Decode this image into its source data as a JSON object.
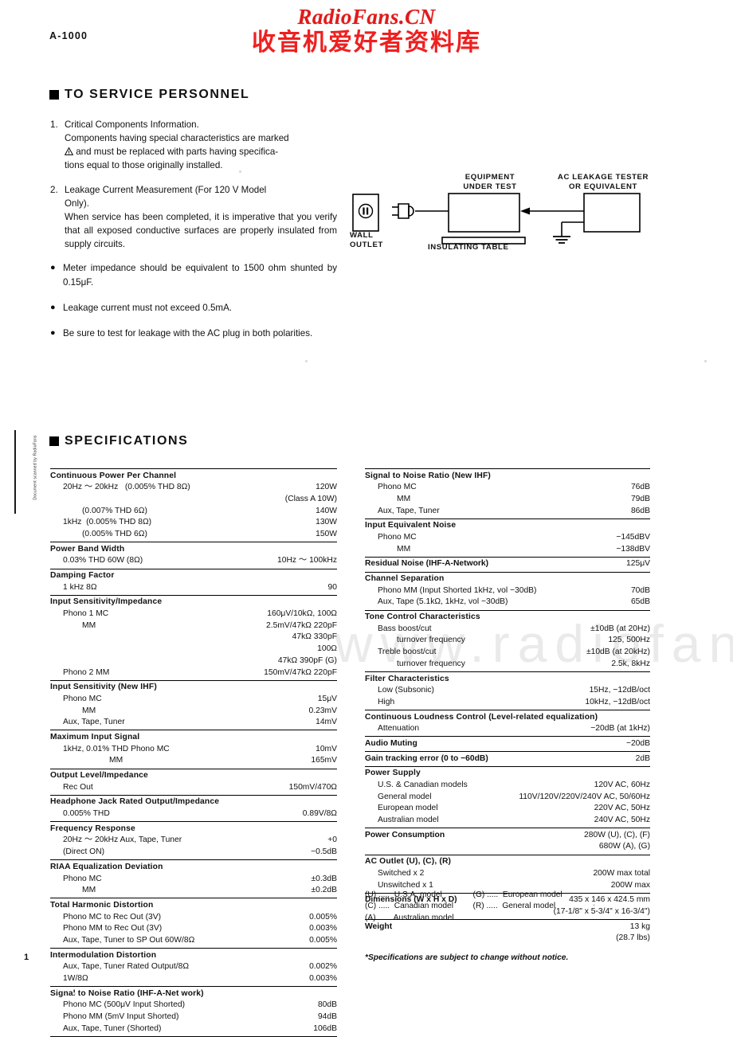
{
  "watermark": {
    "latin": "RadioFans.CN",
    "cjk": "收音机爱好者资料库",
    "middle": "www.radiofans.c"
  },
  "header": {
    "model": "A-1000",
    "page_number": "1",
    "margin_text": "Document scanned by RadioFans"
  },
  "service_section": {
    "heading": "TO SERVICE PERSONNEL",
    "items": [
      {
        "num": "1.",
        "line1": "Critical Components Information.",
        "line2_a": "Components having special characteristics are marked",
        "line2_b": "and must be replaced with parts having specifica-",
        "line2_c": "tions equal to those originally installed."
      },
      {
        "num": "2.",
        "line1": "Leakage Current Measurement (For  120  V  Model",
        "line2": "Only).",
        "line3": "When service has been completed, it is imperative that you verify that all exposed conductive surfaces are properly insulated from supply circuits."
      }
    ],
    "bullets": [
      "Meter  impedance  should  be  equivalent  to  1500  ohm shunted by 0.15μF.",
      "Leakage current must not exceed 0.5mA.",
      "Be  sure  to  test  for  leakage  with  the  AC  plug  in  both polarities."
    ]
  },
  "diagram": {
    "equipment_under_test": "EQUIPMENT\nUNDER TEST",
    "ac_leakage_tester": "AC LEAKAGE TESTER\nOR EQUIVALENT",
    "wall_outlet": "WALL\nOUTLET",
    "insulating_table": "INSULATING TABLE"
  },
  "spec_section": {
    "heading": "SPECIFICATIONS",
    "note": "*Specifications are subject to change without notice.",
    "left_groups": [
      {
        "title": "Continuous Power Per Channel",
        "rows": [
          {
            "indent": 1,
            "label": "20Hz ～ 20kHz   (0.005% THD 8Ω)",
            "value": "120W"
          },
          {
            "indent": 1,
            "label": "",
            "value": "(Class A 10W)"
          },
          {
            "indent": 2,
            "label": "(0.007% THD 6Ω)",
            "value": "140W"
          },
          {
            "indent": 1,
            "label": "1kHz  (0.005% THD 8Ω)",
            "value": "130W"
          },
          {
            "indent": 2,
            "label": "(0.005% THD 6Ω)",
            "value": "150W"
          }
        ]
      },
      {
        "title": "Power Band Width",
        "rows": [
          {
            "indent": 1,
            "label": "0.03% THD 60W (8Ω)",
            "value": "10Hz ～ 100kHz"
          }
        ]
      },
      {
        "title": "Damping Factor",
        "rows": [
          {
            "indent": 1,
            "label": "1 kHz 8Ω",
            "value": "90"
          }
        ]
      },
      {
        "title": "Input Sensitivity/Impedance",
        "rows": [
          {
            "indent": 1,
            "label": "Phono 1 MC",
            "value": "160μV/10kΩ, 100Ω"
          },
          {
            "indent": 2,
            "label": "MM",
            "value": "2.5mV/47kΩ 220pF"
          },
          {
            "indent": 1,
            "label": "",
            "value": "47kΩ 330pF"
          },
          {
            "indent": 1,
            "label": "",
            "value": "100Ω"
          },
          {
            "indent": 1,
            "label": "",
            "value": "47kΩ 390pF  (G)"
          },
          {
            "indent": 1,
            "label": "Phono 2 MM",
            "value": "150mV/47kΩ 220pF"
          }
        ]
      },
      {
        "title": "Input Sensitivity (New IHF)",
        "rows": [
          {
            "indent": 1,
            "label": "Phono MC",
            "value": "15μV"
          },
          {
            "indent": 2,
            "label": "MM",
            "value": "0.23mV"
          },
          {
            "indent": 1,
            "label": "Aux, Tape, Tuner",
            "value": "14mV"
          }
        ]
      },
      {
        "title": "Maximum Input Signal",
        "rows": [
          {
            "indent": 1,
            "label": "1kHz, 0.01% THD Phono MC",
            "value": "10mV"
          },
          {
            "indent": 3,
            "label": "MM",
            "value": "165mV"
          }
        ]
      },
      {
        "title": "Output  Level/Impedance",
        "rows": [
          {
            "indent": 1,
            "label": "Rec Out",
            "value": "150mV/470Ω"
          }
        ]
      },
      {
        "title": "Headphone Jack Rated Output/Impedance",
        "rows": [
          {
            "indent": 1,
            "label": "0.005% THD",
            "value": "0.89V/8Ω"
          }
        ]
      },
      {
        "title": "Frequency Response",
        "rows": [
          {
            "indent": 1,
            "label": "20Hz ～ 20kHz Aux, Tape, Tuner",
            "value": "+0"
          },
          {
            "indent": 1,
            "label": "(Direct ON)",
            "value": "−0.5dB"
          }
        ]
      },
      {
        "title": "RIAA Equalization Deviation",
        "rows": [
          {
            "indent": 1,
            "label": "Phono MC",
            "value": "±0.3dB"
          },
          {
            "indent": 2,
            "label": "MM",
            "value": "±0.2dB"
          }
        ]
      },
      {
        "title": "Total Harmonic Distortion",
        "rows": [
          {
            "indent": 1,
            "label": "Phono MC to Rec Out (3V)",
            "value": "0.005%"
          },
          {
            "indent": 1,
            "label": "Phono MM to Rec Out (3V)",
            "value": "0.003%"
          },
          {
            "indent": 1,
            "label": "Aux, Tape, Tuner to SP Out 60W/8Ω",
            "value": "0.005%"
          }
        ]
      },
      {
        "title": "Intermodulation Distortion",
        "rows": [
          {
            "indent": 1,
            "label": "Aux, Tape, Tuner Rated Output/8Ω",
            "value": "0.002%"
          },
          {
            "indent": 1,
            "label": "1W/8Ω",
            "value": "0.003%"
          }
        ]
      },
      {
        "title": "Signal to Noise Ratio (IHF-A-Net work)",
        "rows": [
          {
            "indent": 1,
            "label": "Phono MC (500μV Input Shorted)",
            "value": "80dB"
          },
          {
            "indent": 1,
            "label": "Phono MM (5mV Input Shorted)",
            "value": "94dB"
          },
          {
            "indent": 1,
            "label": "Aux, Tape, Tuner (Shorted)",
            "value": "106dB"
          }
        ]
      }
    ],
    "right_groups": [
      {
        "title": "Signal to Noise Ratio (New IHF)",
        "rows": [
          {
            "indent": 1,
            "label": "Phono MC",
            "value": "76dB"
          },
          {
            "indent": 2,
            "label": "MM",
            "value": "79dB"
          },
          {
            "indent": 1,
            "label": "Aux, Tape, Tuner",
            "value": "86dB"
          }
        ]
      },
      {
        "title": "Input Equivalent Noise",
        "rows": [
          {
            "indent": 1,
            "label": "Phono MC",
            "value": "−145dBV"
          },
          {
            "indent": 2,
            "label": "MM",
            "value": "−138dBV"
          }
        ]
      },
      {
        "title": "",
        "title_row": {
          "label": "Residual Noise (IHF-A-Network)",
          "value": "125μV"
        },
        "rows": []
      },
      {
        "title": "Channel Separation",
        "rows": [
          {
            "indent": 1,
            "label": "Phono MM (Input Shorted 1kHz, vol −30dB)",
            "value": "70dB"
          },
          {
            "indent": 1,
            "label": "Aux, Tape (5.1kΩ, 1kHz, vol −30dB)",
            "value": "65dB"
          }
        ]
      },
      {
        "title": "Tone Control Characteristics",
        "rows": [
          {
            "indent": 1,
            "label": "Bass boost/cut",
            "value": "±10dB (at 20Hz)"
          },
          {
            "indent": 2,
            "label": "turnover frequency",
            "value": "125, 500Hz"
          },
          {
            "indent": 1,
            "label": "Treble boost/cut",
            "value": "±10dB (at 20kHz)"
          },
          {
            "indent": 2,
            "label": "turnover frequency",
            "value": "2.5k, 8kHz"
          }
        ]
      },
      {
        "title": "Filter Characteristics",
        "rows": [
          {
            "indent": 1,
            "label": "Low (Subsonic)",
            "value": "15Hz, −12dB/oct"
          },
          {
            "indent": 1,
            "label": "High",
            "value": "10kHz, −12dB/oct"
          }
        ]
      },
      {
        "title": "Continuous Loudness Control (Level-related equalization)",
        "rows": [
          {
            "indent": 1,
            "label": "Attenuation",
            "value": "−20dB (at 1kHz)"
          }
        ]
      },
      {
        "title": "",
        "title_row": {
          "label": "Audio Muting",
          "value": "−20dB"
        },
        "rows": []
      },
      {
        "title": "",
        "title_row": {
          "label": "Gain tracking error (0 to −60dB)",
          "value": "2dB"
        },
        "rows": []
      },
      {
        "title": "Power Supply",
        "rows": [
          {
            "indent": 1,
            "label": "U.S. & Canadian models",
            "value": "120V AC, 60Hz"
          },
          {
            "indent": 1,
            "label": "General model",
            "value": "110V/120V/220V/240V AC, 50/60Hz"
          },
          {
            "indent": 1,
            "label": "European model",
            "value": "220V AC, 50Hz"
          },
          {
            "indent": 1,
            "label": "Australian model",
            "value": "240V AC, 50Hz"
          }
        ]
      },
      {
        "title": "",
        "title_row": {
          "label": "Power Consumption",
          "value": "280W (U), (C), (F)"
        },
        "rows": [
          {
            "indent": 1,
            "label": "",
            "value": "680W (A), (G)"
          }
        ]
      },
      {
        "title": "AC Outlet (U), (C), (R)",
        "rows": [
          {
            "indent": 1,
            "label": "Switched x 2",
            "value": "200W max total"
          },
          {
            "indent": 1,
            "label": "Unswitched x 1",
            "value": "200W max"
          }
        ]
      },
      {
        "title": "",
        "title_row": {
          "label": "Dimensions (W x H x D)",
          "value": "435 x 146 x 424.5 mm"
        },
        "rows": [
          {
            "indent": 1,
            "label": "",
            "value": "(17-1/8\" x 5-3/4\" x 16-3/4\")"
          }
        ]
      },
      {
        "title": "",
        "title_row": {
          "label": "Weight",
          "value": "13 kg"
        },
        "rows": [
          {
            "indent": 1,
            "label": "",
            "value": "(28.7 lbs)"
          }
        ]
      }
    ],
    "model_legend": {
      "col1": [
        "(U) .....  U.S.A. model",
        "(C) .....  Canadian model",
        "(A) .....  Australian model"
      ],
      "col2": [
        "(G) .....  European model",
        "(R) .....  General model"
      ]
    }
  }
}
